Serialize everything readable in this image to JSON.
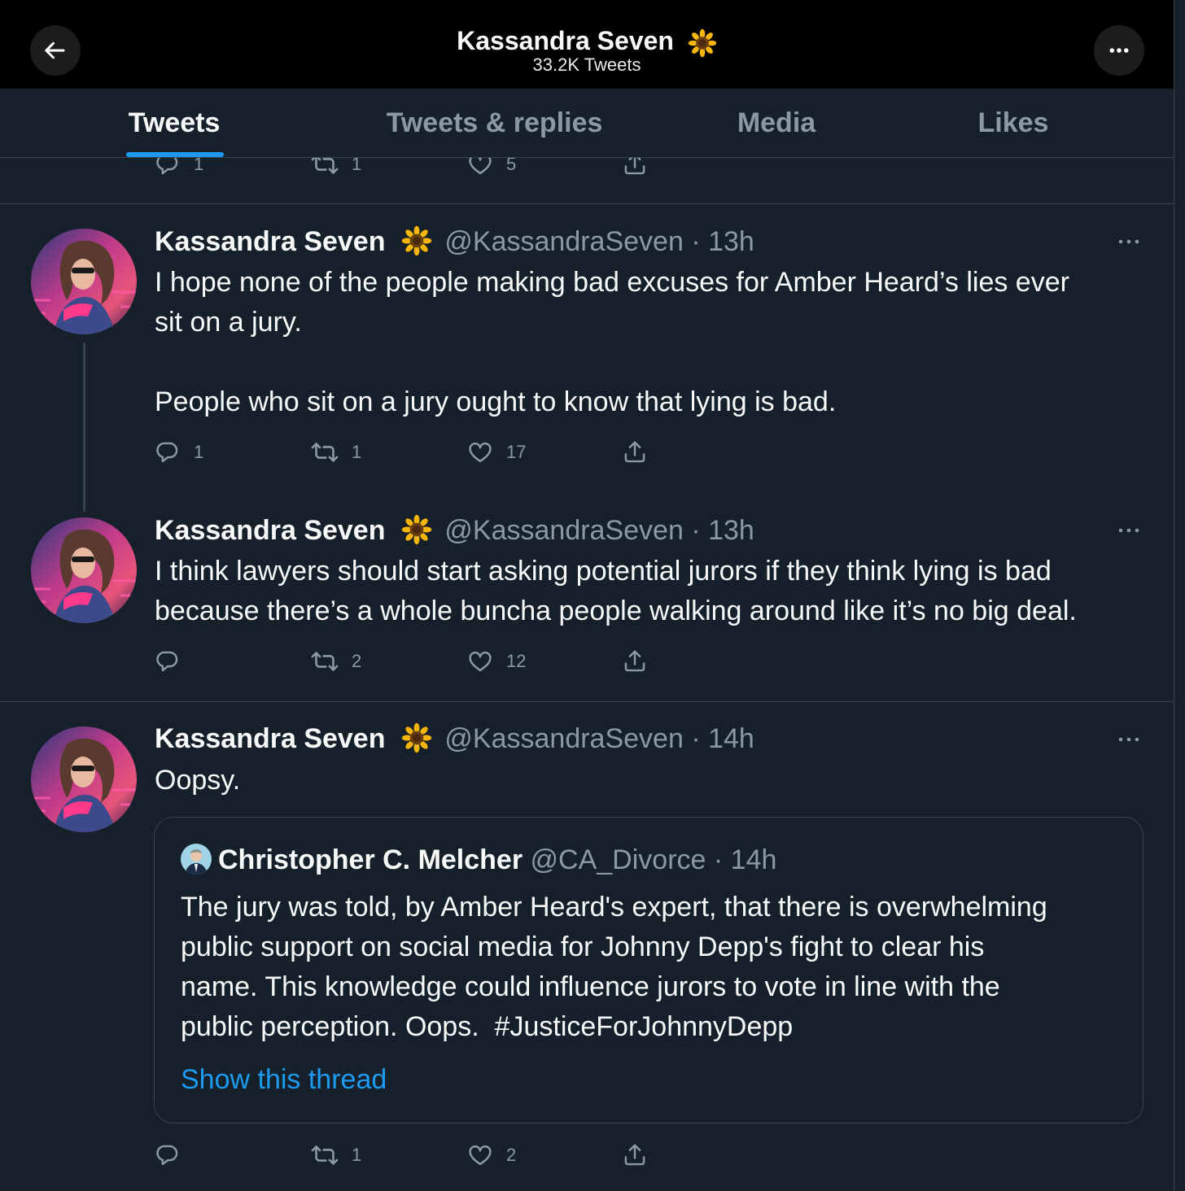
{
  "header": {
    "title": "Kassandra Seven",
    "emoji": "🌻",
    "subtitle": "33.2K Tweets"
  },
  "tabs": [
    {
      "label": "Tweets",
      "active": true
    },
    {
      "label": "Tweets & replies",
      "active": false
    },
    {
      "label": "Media",
      "active": false
    },
    {
      "label": "Likes",
      "active": false
    }
  ],
  "prev_tweet_actions": {
    "replies": "1",
    "retweets": "1",
    "likes": "5"
  },
  "tweets": [
    {
      "name": "Kassandra Seven",
      "emoji": "🌻",
      "handle": "@KassandraSeven",
      "time": "13h",
      "text_line1": "I hope none of the people making bad excuses for Amber Heard’s lies ever",
      "text_line2": "sit on a jury.",
      "text_line3": "People who sit on a jury ought to know that lying is bad.",
      "replies": "1",
      "retweets": "1",
      "likes": "17"
    },
    {
      "name": "Kassandra Seven",
      "emoji": "🌻",
      "handle": "@KassandraSeven",
      "time": "13h",
      "text_line1": "I think lawyers should start asking potential jurors if they think lying is bad",
      "text_line2": "because there’s a whole buncha people walking around like it’s no big deal.",
      "replies": "",
      "retweets": "2",
      "likes": "12"
    },
    {
      "name": "Kassandra Seven",
      "emoji": "🌻",
      "handle": "@KassandraSeven",
      "time": "14h",
      "text_line1": "Oopsy.",
      "quote": {
        "name": "Christopher C. Melcher",
        "handle": "@CA_Divorce",
        "time": "14h",
        "line1": "The jury was told, by Amber Heard's expert, that there is overwhelming",
        "line2": "public support on social media for Johnny Depp's fight to clear his",
        "line3": "name. This knowledge could influence jurors to vote in line with the",
        "line4": "public perception. Oops.  #JusticeForJohnnyDepp",
        "link": "Show this thread"
      },
      "replies": "",
      "retweets": "1",
      "likes": "2"
    }
  ],
  "colors": {
    "background": "#15202b",
    "header": "#000000",
    "accent": "#1d9bf0",
    "muted": "#8b98a5",
    "border": "#38444d"
  }
}
